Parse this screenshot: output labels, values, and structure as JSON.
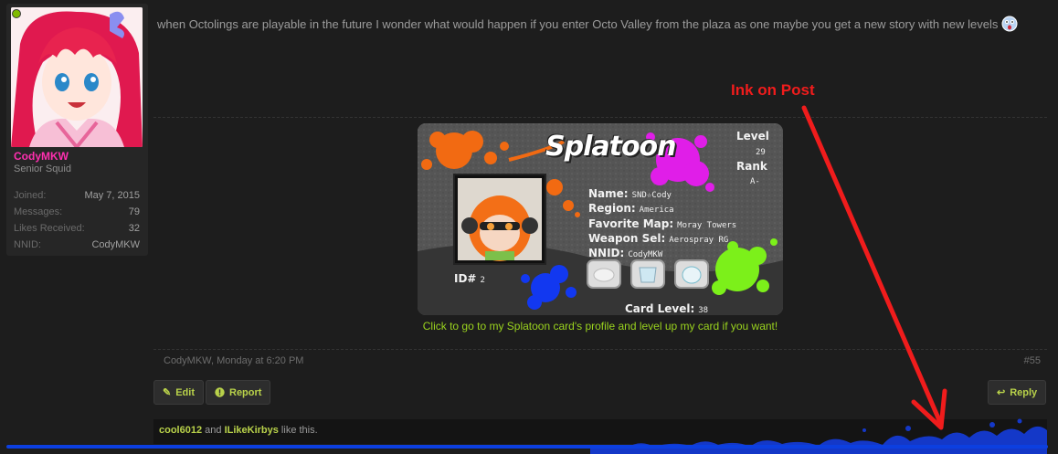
{
  "user": {
    "username": "CodyMKW",
    "title": "Senior Squid",
    "stats": [
      {
        "key": "Joined:",
        "value": "May 7, 2015"
      },
      {
        "key": "Messages:",
        "value": "79"
      },
      {
        "key": "Likes Received:",
        "value": "32"
      },
      {
        "key": "NNID:",
        "value": "CodyMKW"
      }
    ]
  },
  "post": {
    "message": "when Octolings are playable in the future I wonder what would happen if you enter Octo Valley from the plaza as one maybe you get a new story with new levels",
    "author_date": "CodyMKW, Monday at 6:20 PM",
    "number": "#55"
  },
  "signature": {
    "logo": "Splatoon",
    "level_label": "Level",
    "level_value": "29",
    "rank_label": "Rank",
    "rank_value": "A-",
    "fields": [
      {
        "label": "Name:",
        "value": "SND☆Cody"
      },
      {
        "label": "Region:",
        "value": "America"
      },
      {
        "label": "Favorite Map:",
        "value": "Moray Towers"
      },
      {
        "label": "Weapon Sel:",
        "value": "Aerospray RG"
      },
      {
        "label": "NNID:",
        "value": "CodyMKW"
      }
    ],
    "id_label": "ID#",
    "id_value": "2",
    "card_level_label": "Card Level:",
    "card_level_value": "38",
    "link_text": "Click to go to my Splatoon card's profile and level up my card if you want!"
  },
  "actions": {
    "edit": "Edit",
    "report": "Report",
    "reply": "Reply"
  },
  "likes": {
    "user1": "cool6012",
    "and": " and ",
    "user2": "ILikeKirbys",
    "suffix": " like this."
  },
  "annotation": "Ink on Post",
  "colors": {
    "background": "#1d1d1d",
    "username": "#ff2fb0",
    "accent_green": "#b9d24a",
    "link_green": "#9ad31e",
    "annotation_red": "#f01c1c",
    "ink_blue": "#0c3fe0",
    "ink_magenta": "#e01ee8",
    "ink_orange": "#f26a12",
    "ink_lime": "#7cf01a"
  },
  "icons": {
    "edit": "pencil-icon",
    "report": "alert-icon",
    "reply": "reply-arrow-icon",
    "online": "online-dot-icon"
  }
}
